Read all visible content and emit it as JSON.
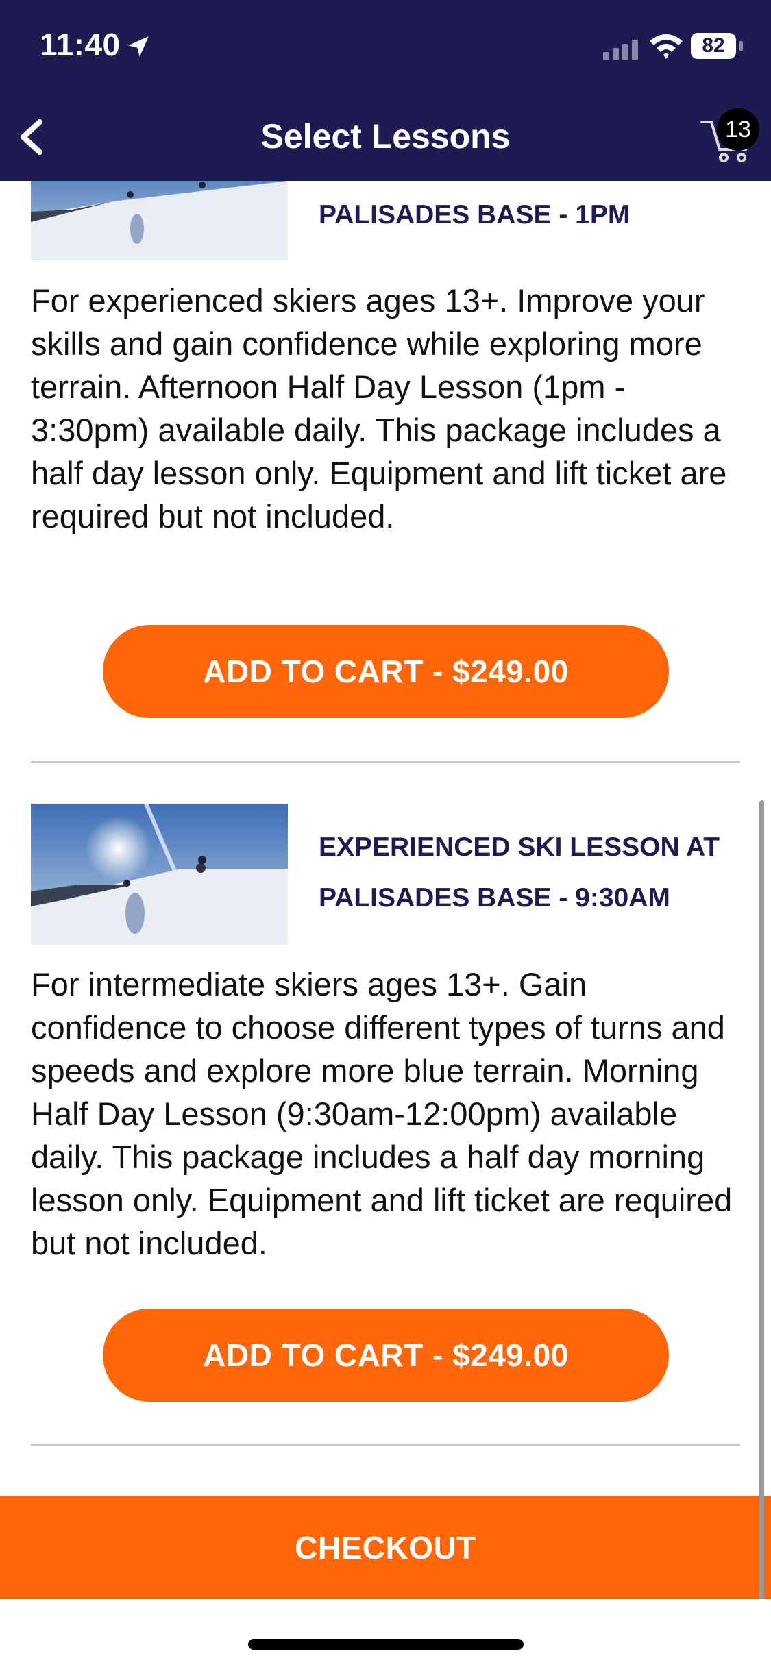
{
  "status_bar": {
    "time": "11:40",
    "battery": "82"
  },
  "header": {
    "title": "Select Lessons",
    "cart_count": "13"
  },
  "lessons": [
    {
      "title": "PALISADES BASE - 1PM",
      "description": "For experienced skiers ages 13+. Improve your skills and gain confidence while exploring more terrain. Afternoon Half Day Lesson (1pm - 3:30pm) available daily. This package includes a half day lesson only. Equipment and lift ticket are required but not included.",
      "button_label": "ADD TO CART - $249.00"
    },
    {
      "title": "EXPERIENCED SKI LESSON AT PALISADES BASE - 9:30AM",
      "description": "For intermediate skiers ages 13+. Gain confidence to choose different types of turns and speeds and explore more blue terrain. Morning Half Day Lesson (9:30am-12:00pm) available daily. This package includes a half day morning lesson only. Equipment and lift ticket are required but not included.",
      "button_label": "ADD TO CART - $249.00"
    }
  ],
  "footer": {
    "checkout_label": "CHECKOUT"
  },
  "colors": {
    "header_bg": "#1e1a52",
    "accent": "#ff6509"
  }
}
